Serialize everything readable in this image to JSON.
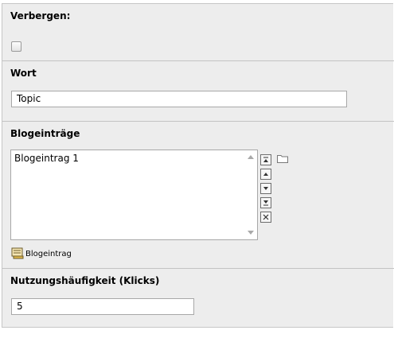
{
  "fields": {
    "hide": {
      "label": "Verbergen:",
      "checked": false
    },
    "word": {
      "label": "Wort",
      "value": "Topic"
    },
    "blog_entries": {
      "label": "Blogeinträge",
      "items": [
        "Blogeintrag 1"
      ],
      "add_record_label": "Blogeintrag",
      "controls": [
        "move-to-top",
        "move-up",
        "move-down",
        "move-to-bottom",
        "remove"
      ]
    },
    "usage": {
      "label": "Nutzungshäufigkeit (Klicks)",
      "value": "5"
    }
  }
}
